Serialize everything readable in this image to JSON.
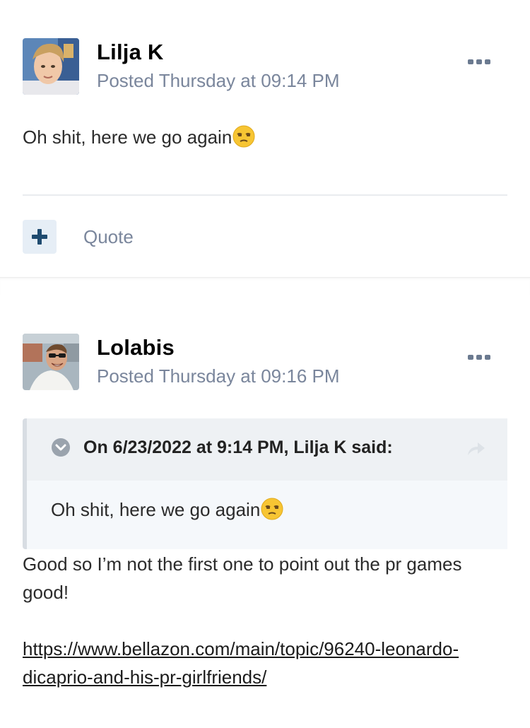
{
  "posts": [
    {
      "author": "Lilja K",
      "meta": "Posted Thursday at 09:14 PM",
      "body": "Oh shit, here we go again",
      "emoji": "unamused-face-emoji",
      "actions": {
        "plus_icon": "plus-icon",
        "quote_label": "Quote"
      },
      "avatar": "avatar-photo-young-man-blond"
    },
    {
      "author": "Lolabis",
      "meta": "Posted Thursday at 09:16 PM",
      "avatar": "avatar-photo-man-sunglasses",
      "quote": {
        "citation": "On 6/23/2022 at 9:14 PM, Lilja K said:",
        "text": "Oh shit, here we go again",
        "emoji": "unamused-face-emoji"
      },
      "body_line1": "Good so I’m not the first one to point out the pr games",
      "body_line2": "good!",
      "link_line1": "https://www.bellazon.com/main/topic/96240-leonardo-",
      "link_line2": "dicaprio-and-his-pr-girlfriends/"
    }
  ],
  "colors": {
    "meta": "#7a869c",
    "quote_bg": "#f5f8fb",
    "quote_head_bg": "#eef1f4",
    "quote_border": "#d8dde3",
    "plus_button_bg": "#e6eef6",
    "plus_icon": "#1f4b70"
  }
}
